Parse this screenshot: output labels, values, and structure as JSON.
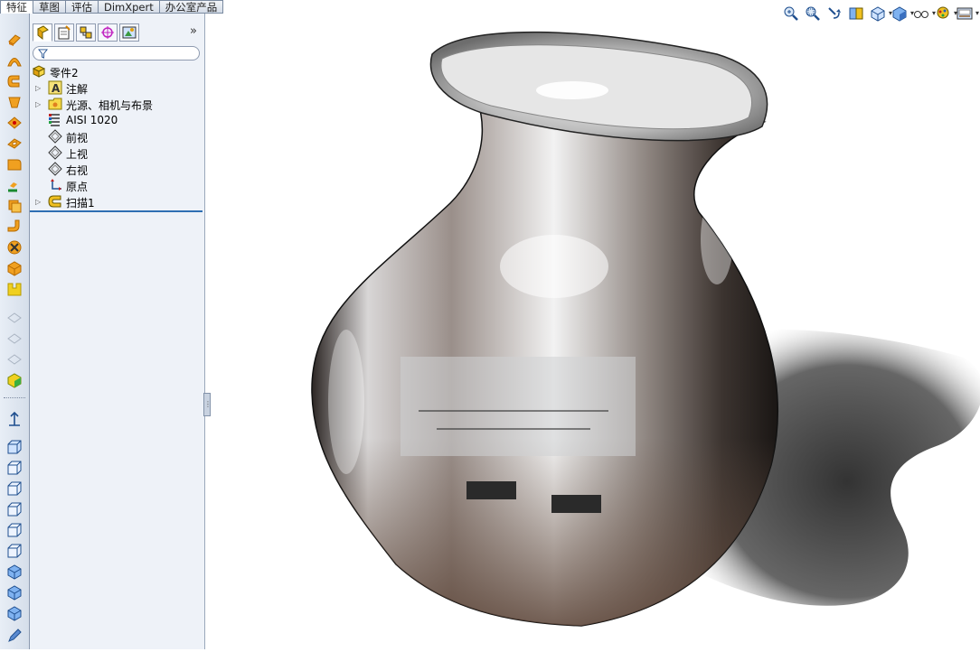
{
  "command_tabs": [
    "特征",
    "草图",
    "评估",
    "DimXpert",
    "办公室产品"
  ],
  "active_tab": "特征",
  "feature_tree": {
    "root": "零件2",
    "items": [
      {
        "label": "注解",
        "icon": "annotations-icon",
        "expandable": true
      },
      {
        "label": "光源、相机与布景",
        "icon": "lights-cameras-scene-icon",
        "expandable": true
      },
      {
        "label": "AISI 1020",
        "icon": "material-icon",
        "expandable": false
      },
      {
        "label": "前视",
        "icon": "plane-icon",
        "expandable": false
      },
      {
        "label": "上视",
        "icon": "plane-icon",
        "expandable": false
      },
      {
        "label": "右视",
        "icon": "plane-icon",
        "expandable": false
      },
      {
        "label": "原点",
        "icon": "origin-icon",
        "expandable": false
      },
      {
        "label": "扫描1",
        "icon": "sweep-icon",
        "expandable": true
      }
    ]
  },
  "panel_chevron": "»",
  "colors": {
    "accent": "#2f6fb3",
    "panel": "#eef2f8",
    "metal": "#8a7468"
  }
}
